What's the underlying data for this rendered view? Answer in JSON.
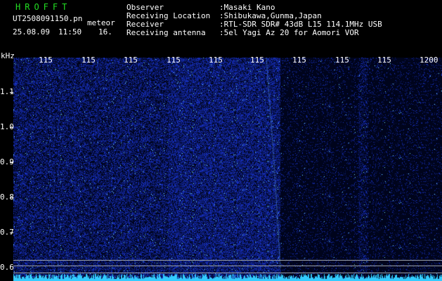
{
  "header": {
    "app_title": "HROFFT",
    "file_name": "UT2508091150.pn",
    "file_tag": "meteor",
    "date": "25.08.09",
    "time": "11:50",
    "count": "16."
  },
  "station_info": [
    {
      "label": "Observer",
      "value": ":Masaki Kano"
    },
    {
      "label": "Receiving Location",
      "value": ":Shibukawa,Gunma,Japan"
    },
    {
      "label": "Receiver",
      "value": ":RTL-SDR SDR# 43dB L15 114.1MHz USB"
    },
    {
      "label": "Receiving antenna",
      "value": ":5el Yagi Az 20 for Aomori VOR"
    }
  ],
  "axes": {
    "unit": "kHz",
    "x_ticks": [
      "115",
      "115",
      "115",
      "115",
      "115",
      "115",
      "115",
      "115",
      "115",
      "1200"
    ],
    "y_ticks": [
      "1.1",
      "1.0",
      "0.9",
      "0.8",
      "0.7",
      "0.6"
    ]
  },
  "colors": {
    "background": "#000000",
    "plot_bg": "#000620",
    "title_green": "#22dd22",
    "noise_blue": "#2a3cff",
    "signal_cyan": "#33ccff"
  }
}
